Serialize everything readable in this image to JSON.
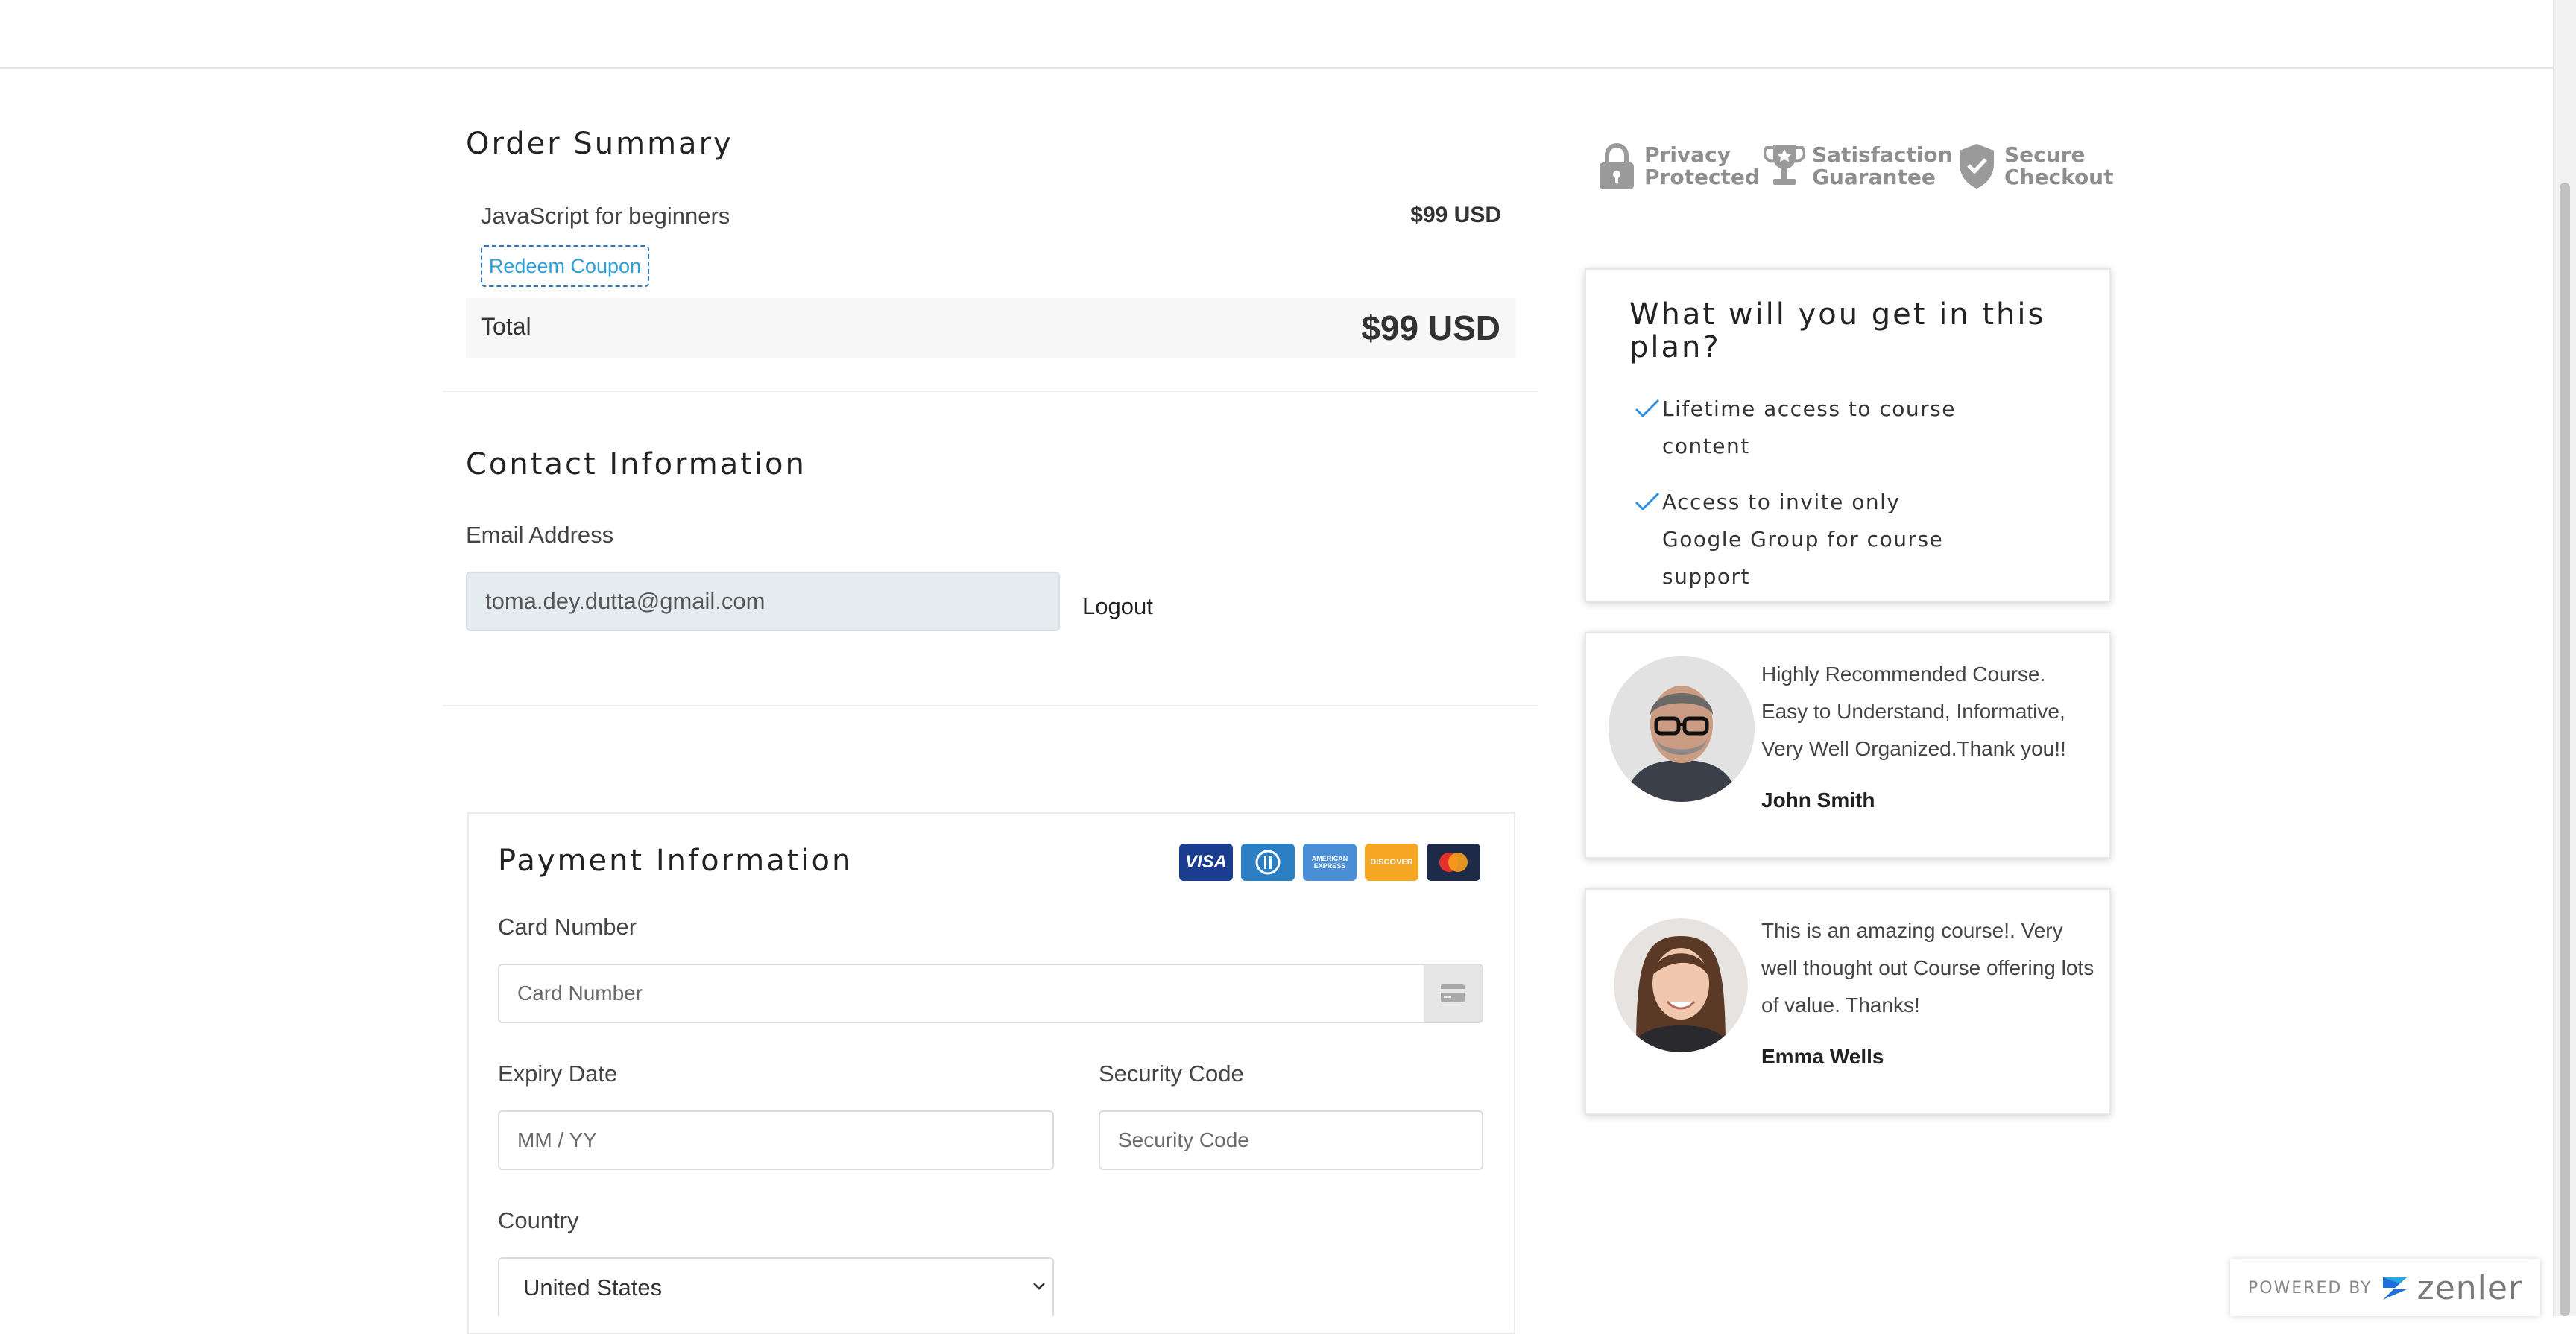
{
  "order_summary": {
    "heading": "Order Summary",
    "product_name": "JavaScript for beginners",
    "product_price": "$99 USD",
    "coupon_label": "Redeem Coupon",
    "total_label": "Total",
    "total_value": "$99 USD"
  },
  "contact": {
    "heading": "Contact Information",
    "email_label": "Email Address",
    "email_value": "toma.dey.dutta@gmail.com",
    "logout_label": "Logout"
  },
  "payment": {
    "heading": "Payment Information",
    "card_brands": [
      "VISA",
      "Diners Club",
      "American Express",
      "DISCOVER",
      "Mastercard"
    ],
    "card_number_label": "Card Number",
    "card_number_placeholder": "Card Number",
    "expiry_label": "Expiry Date",
    "expiry_placeholder": "MM / YY",
    "security_label": "Security Code",
    "security_placeholder": "Security Code",
    "country_label": "Country",
    "country_value": "United States"
  },
  "trust_badges": [
    {
      "line1": "Privacy",
      "line2": "Protected",
      "icon": "lock-icon"
    },
    {
      "line1": "Satisfaction",
      "line2": "Guarantee",
      "icon": "trophy-icon"
    },
    {
      "line1": "Secure",
      "line2": "Checkout",
      "icon": "shield-check-icon"
    }
  ],
  "plan": {
    "heading": "What will you get in this plan?",
    "items": [
      "Lifetime access to course content",
      "Access to invite only Google Group for course support"
    ]
  },
  "reviews": [
    {
      "text": "Highly Recommended Course. Easy to Understand, Informative, Very Well Organized.Thank you!!",
      "name": "John Smith"
    },
    {
      "text": "This is an amazing course!. Very well thought out Course offering lots of value. Thanks!",
      "name": "Emma Wells"
    }
  ],
  "footer": {
    "powered_by": "POWERED BY",
    "brand": "zenler"
  },
  "colors": {
    "link_blue": "#2f9fd8",
    "email_field_bg": "#e4ecf0",
    "check_blue": "#2b8ee0"
  }
}
